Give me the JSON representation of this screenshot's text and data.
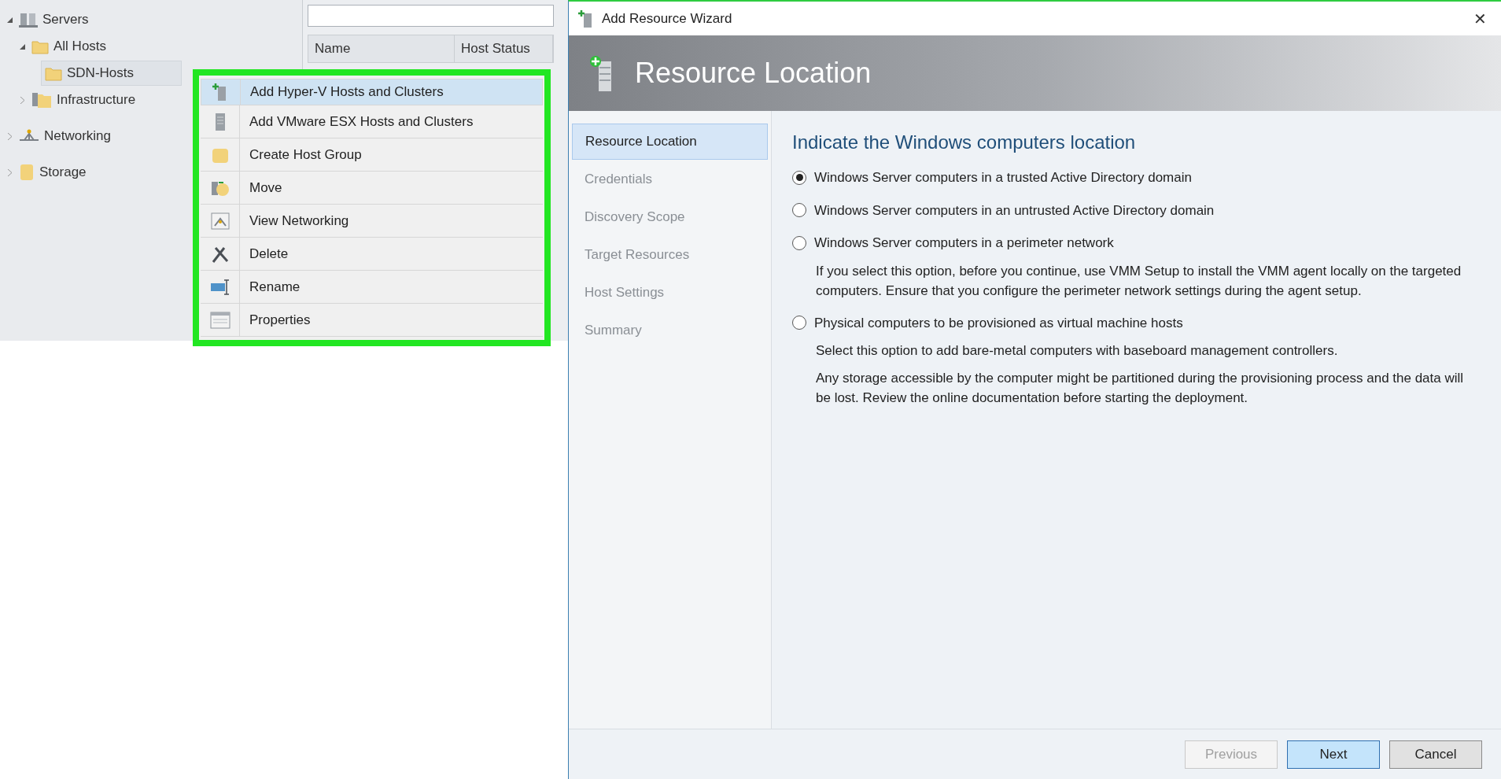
{
  "tree": [
    {
      "label": "Servers",
      "expanded": true,
      "selected": false,
      "children": [
        {
          "label": "All Hosts",
          "expanded": true,
          "selected": false,
          "children": [
            {
              "label": "SDN-Hosts",
              "selected": true
            }
          ]
        },
        {
          "label": "Infrastructure",
          "expanded": false,
          "selected": false
        }
      ]
    },
    {
      "label": "Networking",
      "expanded": false,
      "selected": false
    },
    {
      "label": "Storage",
      "expanded": false,
      "selected": false
    }
  ],
  "grid": {
    "columns": [
      "Name",
      "Host Status"
    ]
  },
  "context_menu": [
    {
      "label": "Add Hyper-V Hosts and Clusters",
      "selected": true
    },
    {
      "label": "Add VMware ESX Hosts and Clusters",
      "selected": false
    },
    {
      "label": "Create Host Group",
      "selected": false
    },
    {
      "label": "Move",
      "selected": false
    },
    {
      "label": "View Networking",
      "selected": false
    },
    {
      "label": "Delete",
      "selected": false
    },
    {
      "label": "Rename",
      "selected": false
    },
    {
      "label": "Properties",
      "selected": false
    }
  ],
  "wizard": {
    "title": "Add Resource Wizard",
    "close": "✕",
    "banner_title": "Resource Location",
    "steps": [
      {
        "label": "Resource Location",
        "selected": true
      },
      {
        "label": "Credentials",
        "selected": false
      },
      {
        "label": "Discovery Scope",
        "selected": false
      },
      {
        "label": "Target Resources",
        "selected": false
      },
      {
        "label": "Host Settings",
        "selected": false
      },
      {
        "label": "Summary",
        "selected": false
      }
    ],
    "heading": "Indicate the Windows computers location",
    "options": [
      {
        "label": "Windows Server computers in a trusted Active Directory domain",
        "selected": true
      },
      {
        "label": "Windows Server computers in an untrusted Active Directory domain",
        "selected": false
      },
      {
        "label": "Windows Server computers in a perimeter network",
        "selected": false,
        "notes": [
          "If you select this option, before you continue, use VMM Setup to install the VMM agent locally on the targeted computers. Ensure that you configure the perimeter network settings during the agent setup."
        ]
      },
      {
        "label": "Physical computers to be provisioned as virtual machine hosts",
        "selected": false,
        "notes": [
          "Select this option to add bare-metal computers with baseboard management controllers.",
          "Any storage accessible by the computer might be partitioned during the provisioning process and the data will be lost. Review the online documentation before starting the deployment."
        ]
      }
    ],
    "buttons": [
      {
        "label": "Previous",
        "disabled": true,
        "focused": false
      },
      {
        "label": "Next",
        "disabled": false,
        "focused": true
      },
      {
        "label": "Cancel",
        "disabled": false,
        "focused": false
      }
    ]
  }
}
